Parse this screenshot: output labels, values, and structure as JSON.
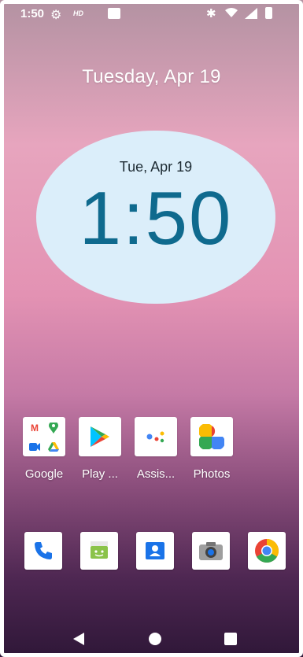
{
  "status": {
    "time": "1:50",
    "hd_label": "HD"
  },
  "header": {
    "date": "Tuesday, Apr 19"
  },
  "clock_widget": {
    "date": "Tue, Apr 19",
    "time": "1:50"
  },
  "apps": [
    {
      "label": "Google",
      "icon": "google-folder-icon"
    },
    {
      "label": "Play ...",
      "icon": "play-store-icon"
    },
    {
      "label": "Assis...",
      "icon": "assistant-icon"
    },
    {
      "label": "Photos",
      "icon": "photos-icon"
    }
  ],
  "google_folder": {
    "m": "M"
  },
  "dock": [
    {
      "icon": "phone-icon"
    },
    {
      "icon": "messages-icon"
    },
    {
      "icon": "contacts-icon"
    },
    {
      "icon": "camera-icon"
    },
    {
      "icon": "chrome-icon"
    }
  ],
  "colors": {
    "clock_bg": "#dbeefa",
    "clock_text": "#0f6a8e",
    "accent_blue": "#1a73e8",
    "play_green": "#34a853"
  }
}
